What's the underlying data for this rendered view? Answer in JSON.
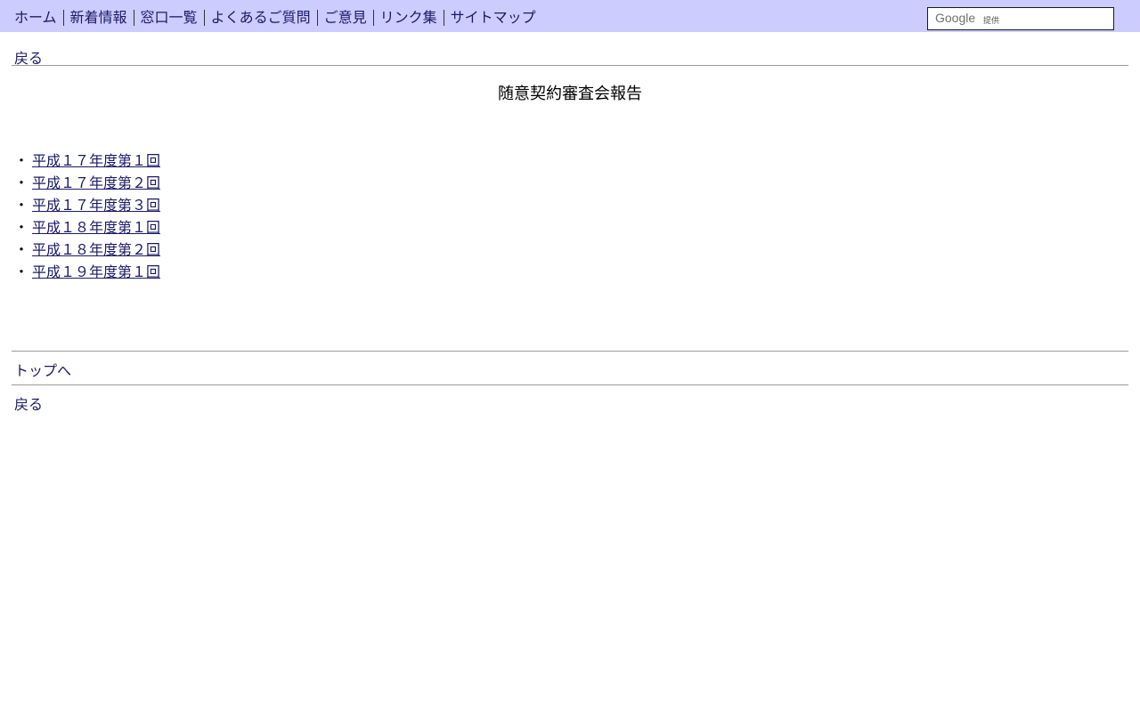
{
  "header": {
    "nav": [
      {
        "label": "ホーム"
      },
      {
        "label": "新着情報"
      },
      {
        "label": "窓口一覧"
      },
      {
        "label": "よくあるご質問"
      },
      {
        "label": "ご意見"
      },
      {
        "label": "リンク集"
      },
      {
        "label": "サイトマップ"
      }
    ],
    "search": {
      "brand": "Google",
      "provided_by": "提供",
      "value": ""
    }
  },
  "back_label": "戻る",
  "page_title": "随意契約審査会報告",
  "bullet": "・",
  "reports": [
    {
      "label": "平成１７年度第１回"
    },
    {
      "label": "平成１７年度第２回"
    },
    {
      "label": "平成１７年度第３回"
    },
    {
      "label": "平成１８年度第１回"
    },
    {
      "label": "平成１８年度第２回"
    },
    {
      "label": "平成１９年度第１回"
    }
  ],
  "to_top_label": "トップへ",
  "colors": {
    "header_bg": "#ccccff",
    "link": "#1a1a66",
    "divider": "#9a9a9a"
  }
}
